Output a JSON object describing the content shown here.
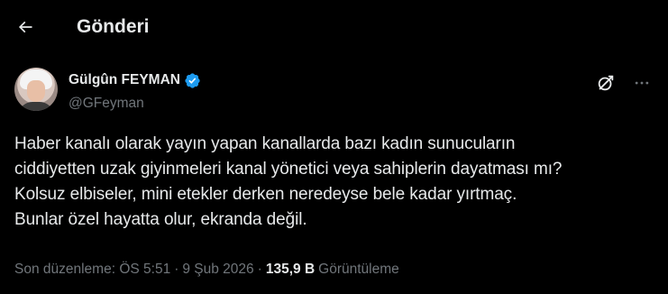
{
  "header": {
    "title": "Gönderi"
  },
  "author": {
    "display_name": "Gülgûn FEYMAN",
    "handle": "@GFeyman",
    "verified": true
  },
  "tweet": {
    "lines": [
      "Haber kanalı olarak yayın yapan kanallarda  bazı kadın sunucuların",
      "ciddiyetten uzak giyinmeleri kanal yönetici veya sahiplerin dayatması mı?",
      "Kolsuz elbiseler, mini etekler derken neredeyse bele kadar yırtmaç.",
      "Bunlar özel hayatta olur, ekranda değil."
    ]
  },
  "meta": {
    "edited_label": "Son düzenleme: ÖS 5:51",
    "separator": "·",
    "date": "9 Şub 2026",
    "views_count": "135,9 B",
    "views_label": "Görüntüleme"
  },
  "colors": {
    "background": "#000000",
    "text_primary": "#e7e9ea",
    "text_secondary": "#71767b",
    "verified_blue": "#1d9bf0"
  },
  "icons": {
    "back": "arrow-left-icon",
    "verified": "verified-badge-icon",
    "grok": "grok-icon",
    "more": "more-horizontal-icon"
  }
}
